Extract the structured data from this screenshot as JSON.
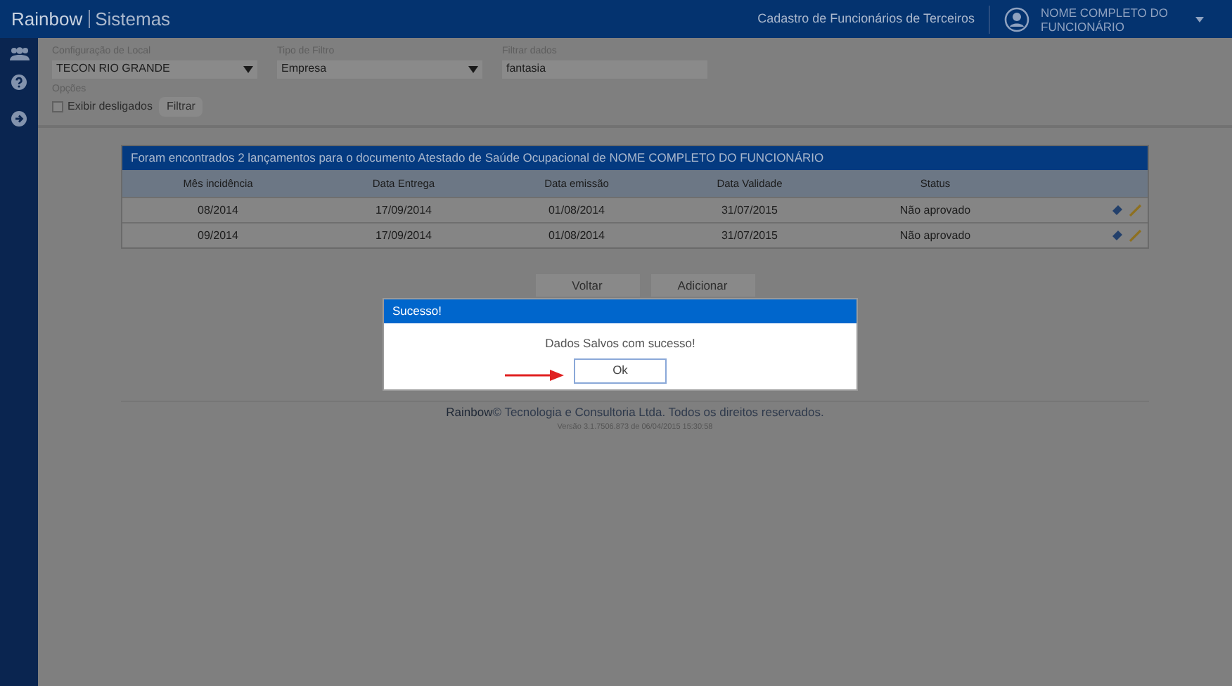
{
  "header": {
    "brand": "Rainbow",
    "product": "Sistemas",
    "page_title": "Cadastro de Funcionários de Terceiros",
    "user": "NOME COMPLETO DO FUNCIONÁRIO"
  },
  "filters": [
    {
      "label": "Configuração de Local",
      "value": "TECON RIO GRANDE",
      "kind": "select"
    },
    {
      "label": "Tipo de Filtro",
      "value": "Empresa",
      "kind": "select"
    },
    {
      "label": "Filtrar dados",
      "value": "fantasia",
      "kind": "text"
    }
  ],
  "options": {
    "label": "Opções",
    "checkbox": {
      "label": "Exibir desligados",
      "checked": false
    },
    "button": "Filtrar"
  },
  "table": {
    "caption": "Foram encontrados 2 lançamentos para o documento Atestado de Saúde Ocupacional de NOME COMPLETO DO FUNCIONÁRIO",
    "columns": [
      "Mês incidência",
      "Data Entrega",
      "Data emissão",
      "Data Validade",
      "Status"
    ],
    "rows": [
      [
        "08/2014",
        "17/09/2014",
        "01/08/2014",
        "31/07/2015",
        "Não aprovado"
      ],
      [
        "09/2014",
        "17/09/2014",
        "01/08/2014",
        "31/07/2015",
        "Não aprovado"
      ]
    ]
  },
  "buttons": [
    "Voltar",
    "Adicionar"
  ],
  "footer": {
    "brand": "Rainbow",
    "text": "© Tecnologia e Consultoria Ltda. Todos os direitos reservados.",
    "version": "Versão 3.1.7506.873 de 06/04/2015 15:30:58"
  },
  "dialog": {
    "title": "Sucesso!",
    "message": "Dados Salvos com sucesso!",
    "button": "Ok"
  }
}
